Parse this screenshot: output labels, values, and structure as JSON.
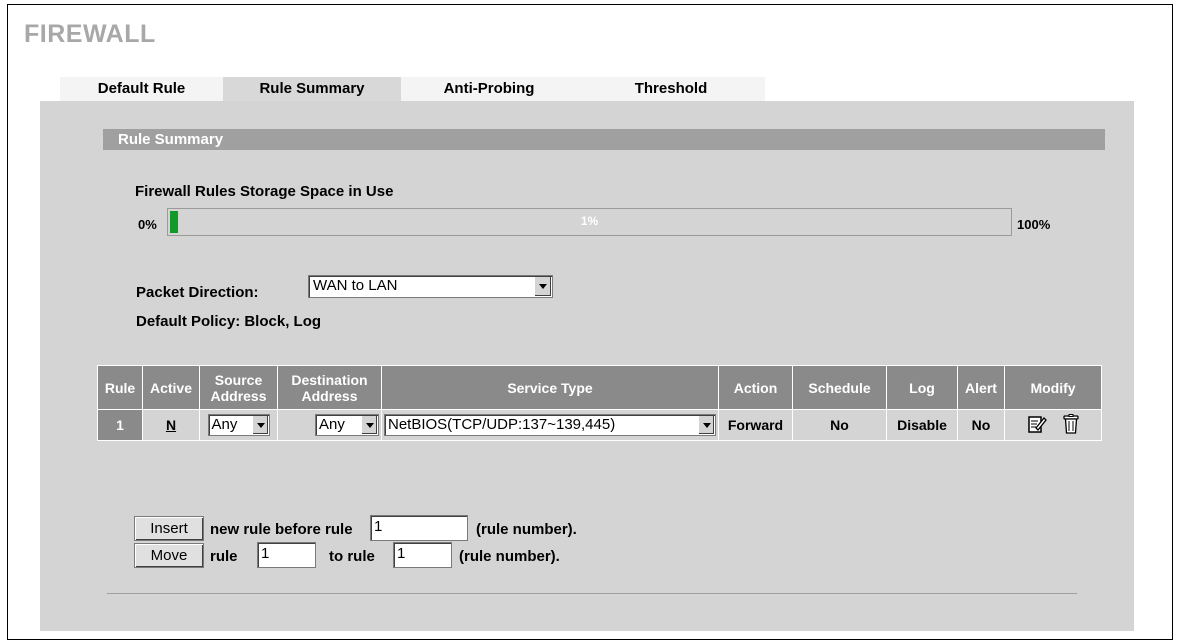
{
  "page_title": "FIREWALL",
  "tabs": [
    {
      "label": "Default Rule",
      "active": false
    },
    {
      "label": "Rule Summary",
      "active": true
    },
    {
      "label": "Anti-Probing",
      "active": false
    },
    {
      "label": "Threshold",
      "active": false
    }
  ],
  "section_title": "Rule Summary",
  "storage": {
    "label": "Firewall Rules Storage Space in Use",
    "min_label": "0%",
    "max_label": "100%",
    "value_label": "1%",
    "value": 1
  },
  "packet_direction": {
    "label": "Packet Direction:",
    "value": "WAN to LAN"
  },
  "default_policy": "Default Policy: Block, Log",
  "table": {
    "headers": {
      "rule": "Rule",
      "active": "Active",
      "source": "Source Address",
      "destination": "Destination Address",
      "service": "Service Type",
      "action": "Action",
      "schedule": "Schedule",
      "log": "Log",
      "alert": "Alert",
      "modify": "Modify"
    },
    "rows": [
      {
        "rule": "1",
        "active": "N",
        "source": "Any",
        "destination": "Any",
        "service": "NetBIOS(TCP/UDP:137~139,445)",
        "action": "Forward",
        "schedule": "No",
        "log": "Disable",
        "alert": "No"
      }
    ]
  },
  "insert": {
    "button": "Insert",
    "text": "new rule before rule",
    "value": "1",
    "suffix": "(rule number)."
  },
  "move": {
    "button": "Move",
    "text": "rule",
    "from_value": "1",
    "to_text": "to rule",
    "to_value": "1",
    "suffix": "(rule number)."
  },
  "colors": {
    "progress_fill": "#119a2a",
    "header_bg": "#8a8a8a",
    "panel_bg": "#d4d4d4"
  },
  "icons": {
    "edit": "edit-icon",
    "delete": "trash-icon"
  }
}
